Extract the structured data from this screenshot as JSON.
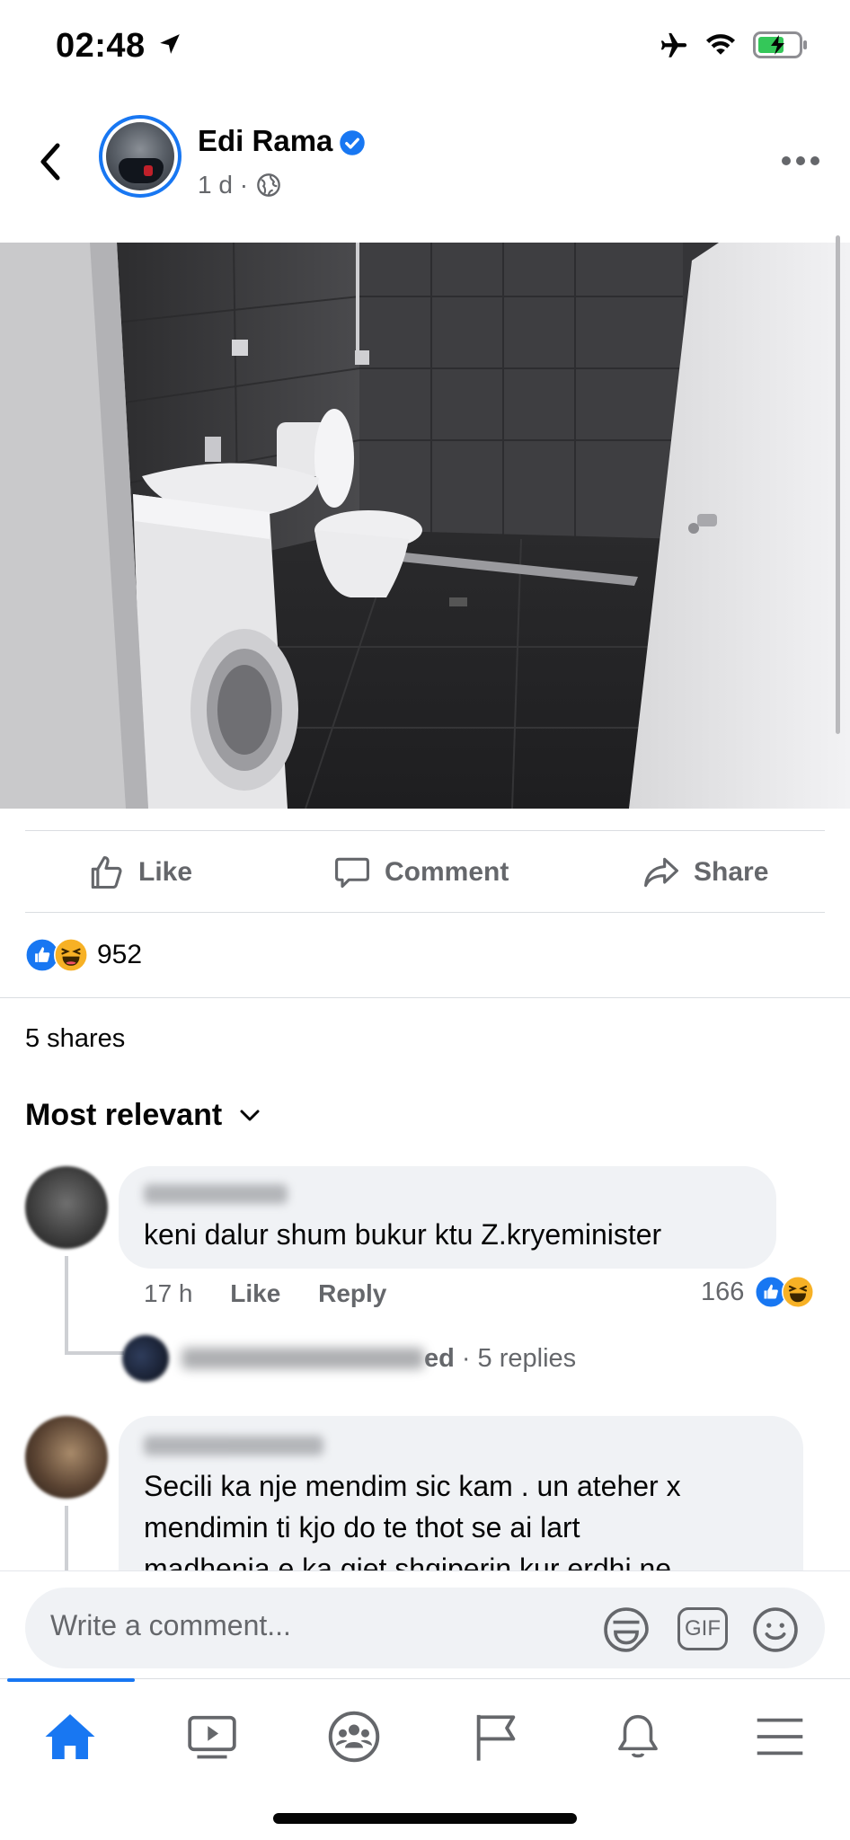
{
  "status_bar": {
    "time": "02:48"
  },
  "post": {
    "author": "Edi Rama",
    "time": "1 d",
    "separator": "·",
    "more_label": "•••"
  },
  "actions": {
    "like": "Like",
    "comment": "Comment",
    "share": "Share"
  },
  "reactions": {
    "count": "952"
  },
  "shares": "5 shares",
  "sort_label": "Most relevant",
  "comments": [
    {
      "text": "keni dalur shum bukur ktu Z.kryeminister",
      "time": "17 h",
      "like": "Like",
      "reply": "Reply",
      "reaction_count": "166",
      "replies_suffix": "ed",
      "replies_count": "· 5 replies"
    },
    {
      "text_lines": [
        "Secili ka nje mendim sic kam . un ateher x",
        "mendimin ti kjo do te thot se ai lart",
        "madhenia e ka gjet shqiperin kur erdhi ne"
      ]
    }
  ],
  "composer": {
    "placeholder": "Write a comment...",
    "gif_label": "GIF"
  },
  "colors": {
    "accent": "#1877f2",
    "secondary_text": "#65676b",
    "bubble": "#f0f2f5"
  }
}
